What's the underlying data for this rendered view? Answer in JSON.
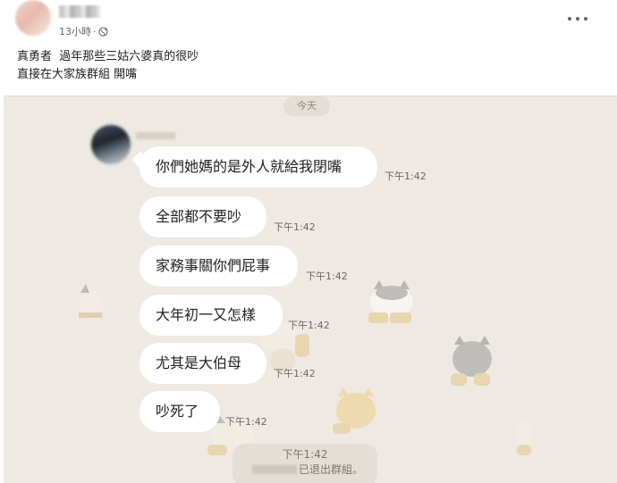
{
  "post": {
    "time": "13小時",
    "separator": "·",
    "text_line1": "真勇者  過年那些三姑六婆真的很吵",
    "text_line2": "直接在大家族群組 開嘴"
  },
  "chat": {
    "date_label": "今天",
    "messages": [
      {
        "text": "你們她媽的是外人就給我閉嘴",
        "time": "下午1:42"
      },
      {
        "text": "全部都不要吵",
        "time": "下午1:42"
      },
      {
        "text": "家務事關你們屁事",
        "time": "下午1:42"
      },
      {
        "text": "大年初一又怎樣",
        "time": "下午1:42"
      },
      {
        "text": "尤其是大伯母",
        "time": "下午1:42"
      },
      {
        "text": "吵死了",
        "time": "下午1:42"
      }
    ],
    "system": {
      "time": "下午1:42",
      "text": "已退出群組。"
    }
  },
  "colors": {
    "chat_bg": "#eee9e2",
    "bubble": "#ffffff",
    "text": "#1c1e21",
    "meta": "#65676b"
  },
  "icons": {
    "privacy": "globe-icon",
    "menu": "more-options-icon"
  }
}
